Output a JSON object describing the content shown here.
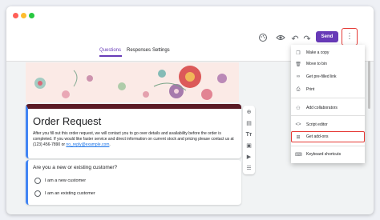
{
  "tabs": [
    {
      "label": "Questions",
      "active": true
    },
    {
      "label": "Responses",
      "active": false
    },
    {
      "label": "Settings",
      "active": false
    }
  ],
  "toolbar": {
    "send_label": "Send",
    "icons": [
      "palette-icon",
      "preview-eye-icon",
      "undo-icon",
      "redo-icon",
      "more-vert-icon"
    ]
  },
  "form": {
    "title": "Order Request",
    "description": "After you fill out this order request, we will contact you to go over details and availability before the order is completed. If you would like faster service and direct information on current stock and pricing please contact us at (123) 456-7890 or",
    "email": "no_reply@example.com",
    "description_end": "."
  },
  "question": {
    "title": "Are you a new or existing customer?",
    "options": [
      "I am a new customer",
      "I am an existing customer"
    ]
  },
  "menu": {
    "items": [
      {
        "label": "Make a copy",
        "icon": "copy-icon"
      },
      {
        "label": "Move to bin",
        "icon": "trash-icon"
      },
      {
        "label": "Get pre-filled link",
        "icon": "link-icon"
      },
      {
        "label": "Print",
        "icon": "print-icon"
      },
      {
        "label": "Add collaborators",
        "icon": "add-person-icon"
      },
      {
        "label": "Script editor",
        "icon": "code-icon"
      },
      {
        "label": "Get add-ons",
        "icon": "add-ons-icon",
        "highlighted": true
      },
      {
        "label": "Keyboard shortcuts",
        "icon": "keyboard-icon"
      }
    ]
  },
  "colors": {
    "accent": "#673ab7",
    "header_bar": "#5a1a25",
    "highlight": "#e53935"
  }
}
